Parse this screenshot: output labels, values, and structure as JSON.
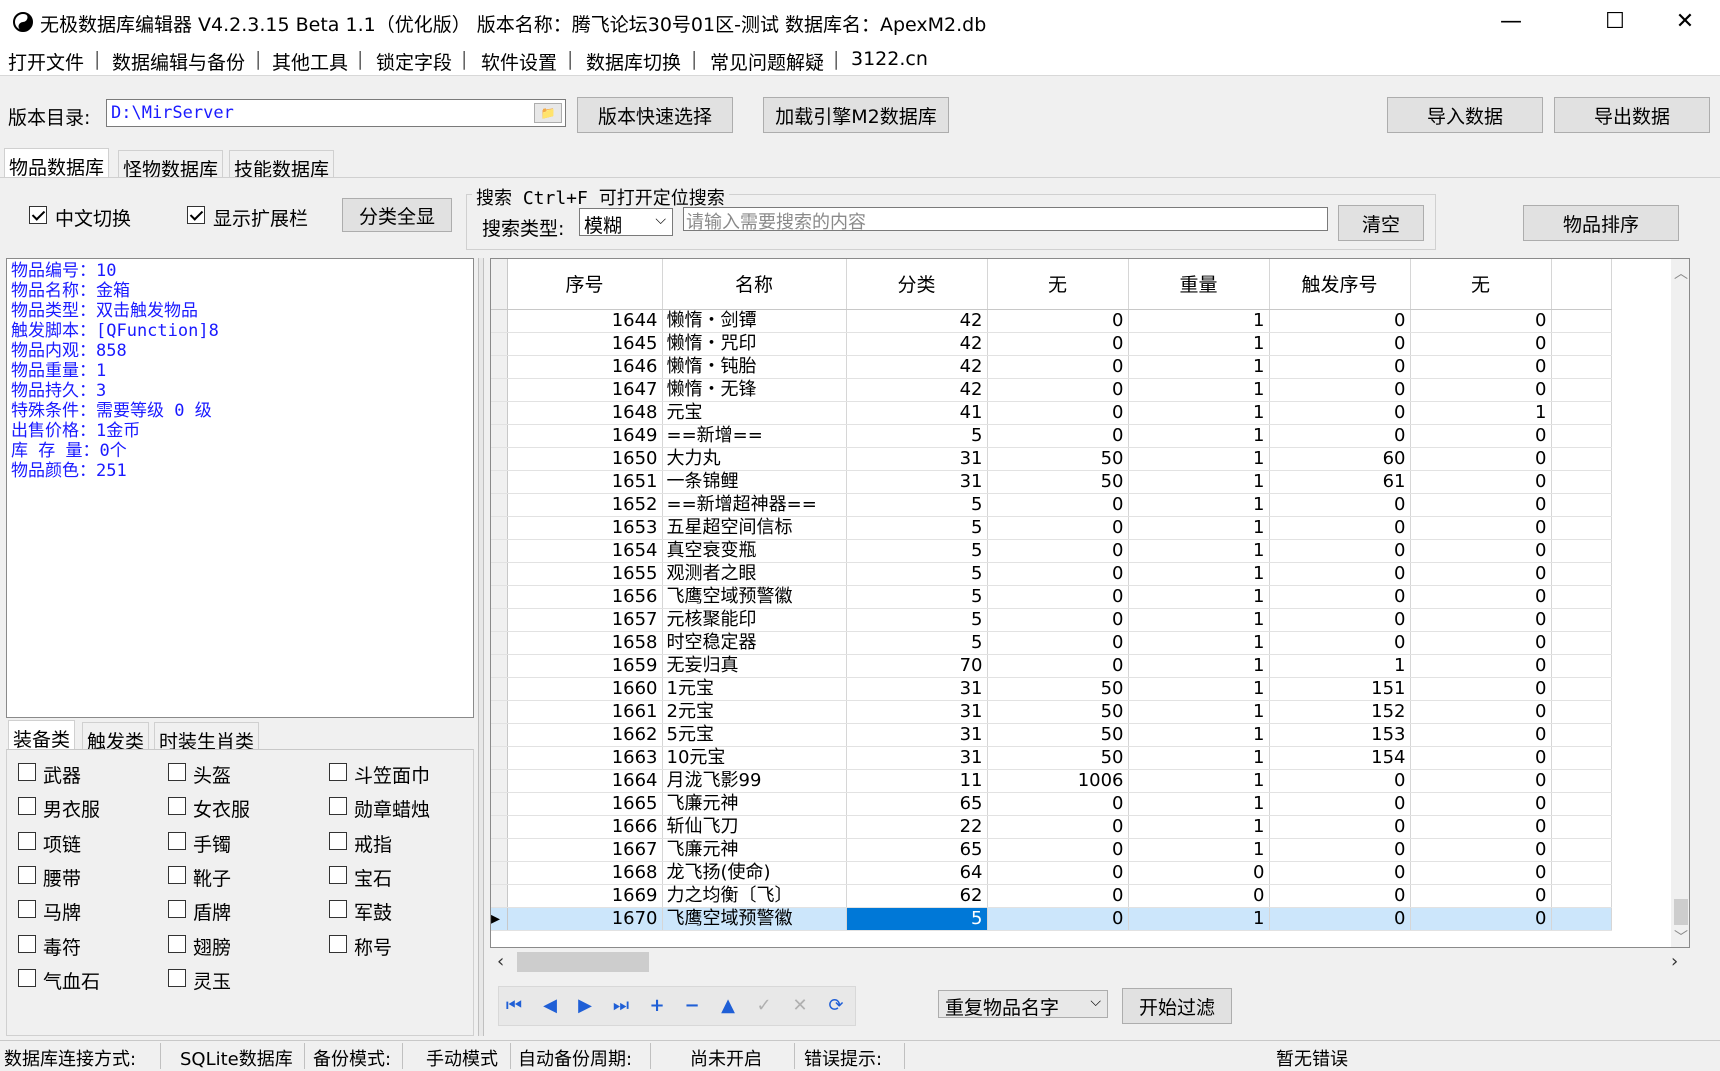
{
  "window": {
    "title": "无极数据库编辑器 V4.2.3.15   Beta 1.1（优化版）   版本名称：腾飞论坛30号01区-测试   数据库名：ApexM2.db",
    "minimize_glyph": "—",
    "maximize_glyph": "☐",
    "close_glyph": "✕"
  },
  "menu": [
    "打开文件",
    "数据编辑与备份",
    "其他工具",
    "锁定字段",
    "软件设置",
    "数据库切换",
    "常见问题解疑",
    "3122.cn"
  ],
  "toolbar": {
    "dir_label": "版本目录:",
    "dir_value": "D:\\MirServer",
    "quick_select": "版本快速选择",
    "load_m2": "加载引擎M2数据库",
    "import": "导入数据",
    "export": "导出数据"
  },
  "tabs": [
    "物品数据库",
    "怪物数据库",
    "技能数据库"
  ],
  "options": {
    "chinese_switch": "中文切换",
    "show_ext": "显示扩展栏",
    "show_all": "分类全显"
  },
  "search": {
    "group_title": "搜索   Ctrl+F 可打开定位搜索",
    "type_label": "搜索类型:",
    "type_value": "模糊",
    "placeholder": "请输入需要搜索的内容",
    "clear": "清空",
    "sort": "物品排序"
  },
  "info": [
    "物品编号：10",
    "物品名称：金箱",
    "物品类型：双击触发物品",
    "触发脚本：[QFunction]8",
    "物品内观：858",
    "物品重量：1",
    "物品持久：3",
    "特殊条件：需要等级 0 级",
    "出售价格：1金币",
    "库 存 量：0个",
    "物品颜色：251"
  ],
  "subtabs": [
    "装备类",
    "触发类",
    "时装生肖类"
  ],
  "categories": [
    [
      "武器",
      "头盔",
      "斗笠面巾"
    ],
    [
      "男衣服",
      "女衣服",
      "勋章蜡烛"
    ],
    [
      "项链",
      "手镯",
      "戒指"
    ],
    [
      "腰带",
      "靴子",
      "宝石"
    ],
    [
      "马牌",
      "盾牌",
      "军鼓"
    ],
    [
      "毒符",
      "翅膀",
      "称号"
    ],
    [
      "气血石",
      "灵玉"
    ]
  ],
  "grid": {
    "headers": [
      "序号",
      "名称",
      "分类",
      "无",
      "重量",
      "触发序号",
      "无"
    ],
    "rows": [
      [
        "1644",
        "懒惰・剑镡",
        "42",
        "0",
        "1",
        "0",
        "0"
      ],
      [
        "1645",
        "懒惰・咒印",
        "42",
        "0",
        "1",
        "0",
        "0"
      ],
      [
        "1646",
        "懒惰・钝胎",
        "42",
        "0",
        "1",
        "0",
        "0"
      ],
      [
        "1647",
        "懒惰・无锋",
        "42",
        "0",
        "1",
        "0",
        "0"
      ],
      [
        "1648",
        "元宝",
        "41",
        "0",
        "1",
        "0",
        "1"
      ],
      [
        "1649",
        "==新增==",
        "5",
        "0",
        "1",
        "0",
        "0"
      ],
      [
        "1650",
        "大力丸",
        "31",
        "50",
        "1",
        "60",
        "0"
      ],
      [
        "1651",
        "一条锦鲤",
        "31",
        "50",
        "1",
        "61",
        "0"
      ],
      [
        "1652",
        "==新增超神器==",
        "5",
        "0",
        "1",
        "0",
        "0"
      ],
      [
        "1653",
        "五星超空间信标",
        "5",
        "0",
        "1",
        "0",
        "0"
      ],
      [
        "1654",
        "真空衰变瓶",
        "5",
        "0",
        "1",
        "0",
        "0"
      ],
      [
        "1655",
        "观测者之眼",
        "5",
        "0",
        "1",
        "0",
        "0"
      ],
      [
        "1656",
        "飞鹰空域预警徽",
        "5",
        "0",
        "1",
        "0",
        "0"
      ],
      [
        "1657",
        "元核聚能印",
        "5",
        "0",
        "1",
        "0",
        "0"
      ],
      [
        "1658",
        "时空稳定器",
        "5",
        "0",
        "1",
        "0",
        "0"
      ],
      [
        "1659",
        "无妄归真",
        "70",
        "0",
        "1",
        "1",
        "0"
      ],
      [
        "1660",
        "1元宝",
        "31",
        "50",
        "1",
        "151",
        "0"
      ],
      [
        "1661",
        "2元宝",
        "31",
        "50",
        "1",
        "152",
        "0"
      ],
      [
        "1662",
        "5元宝",
        "31",
        "50",
        "1",
        "153",
        "0"
      ],
      [
        "1663",
        "10元宝",
        "31",
        "50",
        "1",
        "154",
        "0"
      ],
      [
        "1664",
        "月泷飞影99",
        "11",
        "1006",
        "1",
        "0",
        "0"
      ],
      [
        "1665",
        "飞廉元神",
        "65",
        "0",
        "1",
        "0",
        "0"
      ],
      [
        "1666",
        "斩仙飞刀",
        "22",
        "0",
        "1",
        "0",
        "0"
      ],
      [
        "1667",
        "飞廉元神",
        "65",
        "0",
        "1",
        "0",
        "0"
      ],
      [
        "1668",
        "龙飞扬(使命)",
        "64",
        "0",
        "0",
        "0",
        "0"
      ],
      [
        "1669",
        "力之均衡〔飞〕",
        "62",
        "0",
        "0",
        "0",
        "0"
      ],
      [
        "1670",
        "飞鹰空域预警徽",
        "5",
        "0",
        "1",
        "0",
        "0"
      ]
    ]
  },
  "filter": {
    "type_value": "重复物品名字",
    "start": "开始过滤"
  },
  "status": {
    "conn_label": "数据库连接方式:",
    "conn_value": "SQLite数据库",
    "backup_label": "备份模式:",
    "backup_value": "手动模式",
    "auto_label": "自动备份周期:",
    "auto_value": "尚未开启",
    "err_label": "错误提示:",
    "err_value": "暂无错误"
  }
}
